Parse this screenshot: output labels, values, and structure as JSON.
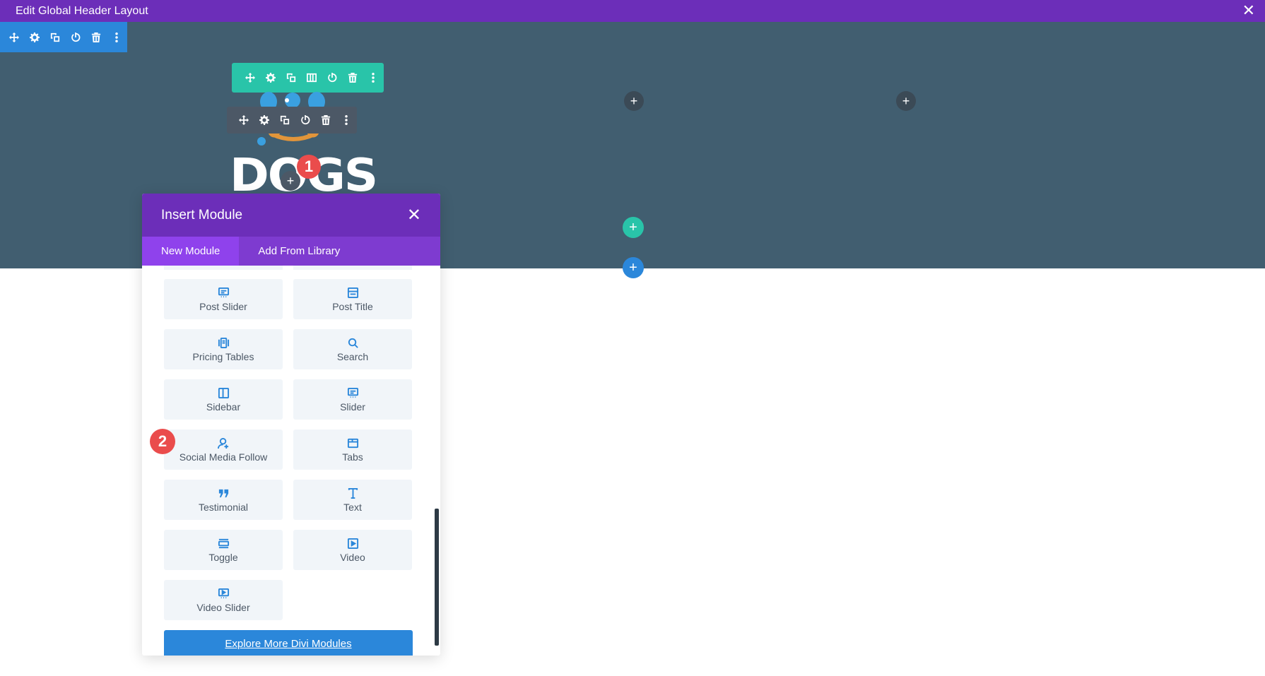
{
  "window": {
    "title": "Edit Global Header Layout",
    "close_icon": "close-icon"
  },
  "logo": {
    "text": "DOGS"
  },
  "badges": {
    "first": "1",
    "second": "2"
  },
  "add_buttons": {
    "symbol": "+"
  },
  "insert_module": {
    "title": "Insert Module",
    "close_symbol": "✕",
    "tabs": [
      {
        "label": "New Module",
        "active": true
      },
      {
        "label": "Add From Library",
        "active": false
      }
    ],
    "modules": [
      {
        "label": "Post Slider",
        "icon": "post-slider-icon"
      },
      {
        "label": "Post Title",
        "icon": "post-title-icon"
      },
      {
        "label": "Pricing Tables",
        "icon": "pricing-tables-icon"
      },
      {
        "label": "Search",
        "icon": "search-icon"
      },
      {
        "label": "Sidebar",
        "icon": "sidebar-icon"
      },
      {
        "label": "Slider",
        "icon": "slider-icon"
      },
      {
        "label": "Social Media Follow",
        "icon": "social-follow-icon"
      },
      {
        "label": "Tabs",
        "icon": "tabs-icon"
      },
      {
        "label": "Testimonial",
        "icon": "testimonial-icon"
      },
      {
        "label": "Text",
        "icon": "text-icon"
      },
      {
        "label": "Toggle",
        "icon": "toggle-icon"
      },
      {
        "label": "Video",
        "icon": "video-icon"
      },
      {
        "label": "Video Slider",
        "icon": "video-slider-icon"
      }
    ],
    "explore_label": "Explore More Divi Modules"
  },
  "colors": {
    "top_bar": "#6c2eb9",
    "canvas": "#415e70",
    "section_toolbar": "#2b87da",
    "row_toolbar": "#29c4a9",
    "module_toolbar": "#4c5866",
    "badge": "#ea4c4c"
  }
}
